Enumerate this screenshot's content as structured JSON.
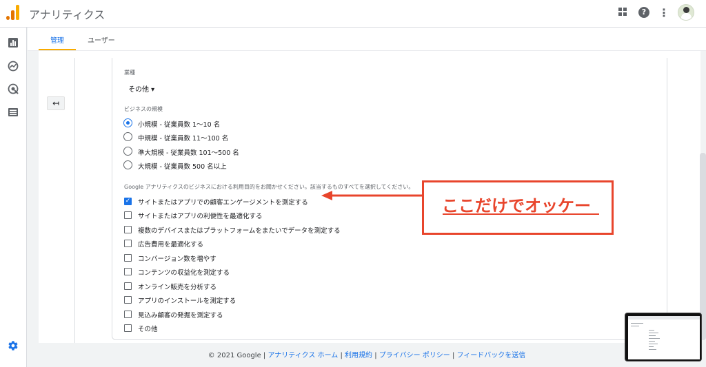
{
  "app": {
    "title": "アナリティクス"
  },
  "topbar": {
    "apps_icon": "grid-icon",
    "help_icon": "help-icon",
    "more_icon": "more-vert-icon",
    "help_glyph": "?",
    "more_glyph": "⋮"
  },
  "sidenav": {
    "items": [
      {
        "icon": "bar-chart-icon"
      },
      {
        "icon": "insights-icon"
      },
      {
        "icon": "explore-icon"
      },
      {
        "icon": "list-icon"
      }
    ],
    "settings_icon": "gear-icon"
  },
  "tabs": [
    {
      "label": "管理",
      "active": true
    },
    {
      "label": "ユーザー",
      "active": false
    }
  ],
  "back_button": {
    "glyph": "↤"
  },
  "form": {
    "industry": {
      "label": "業種",
      "value": "その他 ▾"
    },
    "business_size": {
      "label": "ビジネスの規模",
      "options": [
        {
          "label": "小規模 - 従業員数 1〜10 名",
          "checked": true
        },
        {
          "label": "中規模 - 従業員数 11〜100 名",
          "checked": false
        },
        {
          "label": "準大規模 - 従業員数 101〜500 名",
          "checked": false
        },
        {
          "label": "大規模 - 従業員数 500 名以上",
          "checked": false
        }
      ]
    },
    "purpose": {
      "label": "Google アナリティクスのビジネスにおける利用目的をお聞かせください。該当するものすべてを選択してください。",
      "options": [
        {
          "label": "サイトまたはアプリでの顧客エンゲージメントを測定する",
          "checked": true
        },
        {
          "label": "サイトまたはアプリの利便性を最適化する",
          "checked": false
        },
        {
          "label": "複数のデバイスまたはプラットフォームをまたいでデータを測定する",
          "checked": false
        },
        {
          "label": "広告費用を最適化する",
          "checked": false
        },
        {
          "label": "コンバージョン数を増やす",
          "checked": false
        },
        {
          "label": "コンテンツの収益化を測定する",
          "checked": false
        },
        {
          "label": "オンライン販売を分析する",
          "checked": false
        },
        {
          "label": "アプリのインストールを測定する",
          "checked": false
        },
        {
          "label": "見込み顧客の発掘を測定する",
          "checked": false
        },
        {
          "label": "その他",
          "checked": false
        }
      ]
    }
  },
  "annotation": {
    "text": "ここだけでオッケー",
    "color": "#e8452c"
  },
  "footer": {
    "copyright": "© 2021 Google |",
    "links": [
      "アナリティクス ホーム",
      "利用規約",
      "プライバシー ポリシー",
      "フィードバックを送信"
    ],
    "separator": " | "
  },
  "colors": {
    "accent": "#1a73e8",
    "tab_underline": "#f9ab00",
    "annotation": "#e8452c"
  }
}
